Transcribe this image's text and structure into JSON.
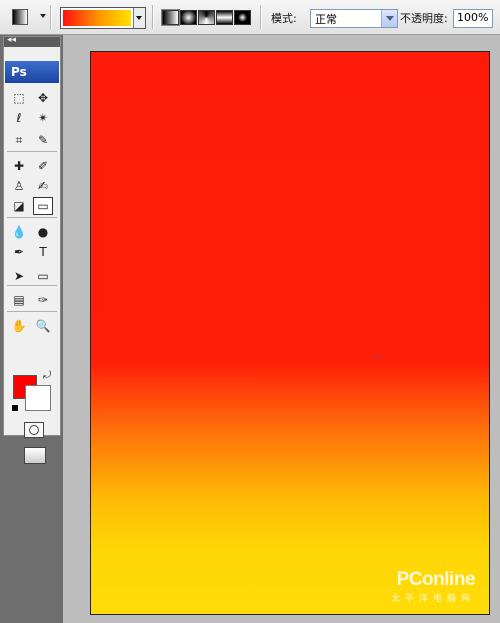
{
  "options_bar": {
    "mode_label": "模式:",
    "mode_value": "正常",
    "opacity_label": "不透明度:",
    "opacity_value": "100%",
    "gradient_colors": [
      "#ff1010",
      "#ff9a00",
      "#ffe000"
    ],
    "gradient_types": [
      "linear",
      "radial",
      "angle",
      "reflected",
      "diamond"
    ]
  },
  "toolbox": {
    "logo": "Ps",
    "collapse_glyph": "◂◂",
    "foreground_color": "#ff0000",
    "background_color": "#ffffff",
    "tools": [
      {
        "name": "marquee-tool",
        "glyph": "⬚"
      },
      {
        "name": "move-tool",
        "glyph": "✥"
      },
      {
        "name": "lasso-tool",
        "glyph": "ℓ"
      },
      {
        "name": "magic-wand-tool",
        "glyph": "✴"
      },
      {
        "name": "crop-tool",
        "glyph": "⌗"
      },
      {
        "name": "slice-tool",
        "glyph": "✎"
      },
      {
        "name": "healing-brush-tool",
        "glyph": "✚"
      },
      {
        "name": "brush-tool",
        "glyph": "✐"
      },
      {
        "name": "clone-stamp-tool",
        "glyph": "♙"
      },
      {
        "name": "history-brush-tool",
        "glyph": "✍"
      },
      {
        "name": "eraser-tool",
        "glyph": "◪"
      },
      {
        "name": "gradient-tool",
        "glyph": "▭"
      },
      {
        "name": "blur-tool",
        "glyph": "💧"
      },
      {
        "name": "dodge-tool",
        "glyph": "●"
      },
      {
        "name": "pen-tool",
        "glyph": "✒"
      },
      {
        "name": "type-tool",
        "glyph": "T"
      },
      {
        "name": "path-selection-tool",
        "glyph": "➤"
      },
      {
        "name": "shape-tool",
        "glyph": "▭"
      },
      {
        "name": "notes-tool",
        "glyph": "▤"
      },
      {
        "name": "eyedropper-tool",
        "glyph": "✑"
      },
      {
        "name": "hand-tool",
        "glyph": "✋"
      },
      {
        "name": "zoom-tool",
        "glyph": "🔍"
      }
    ]
  },
  "watermark": {
    "brand": "PConline",
    "subtitle": "太平洋电脑网"
  },
  "canvas": {
    "gradient_top": "#ff1a0a",
    "gradient_bottom": "#ffdc07"
  }
}
